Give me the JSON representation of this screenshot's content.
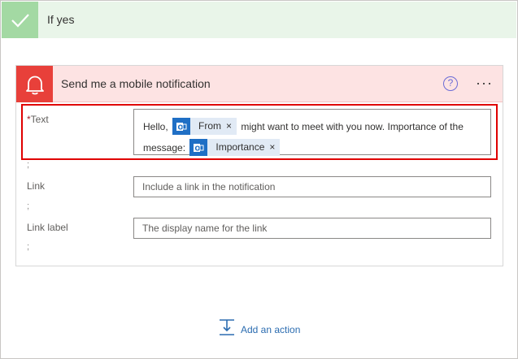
{
  "branch": {
    "title": "If yes",
    "check_icon": "checkmark-icon"
  },
  "card": {
    "title": "Send me a mobile notification",
    "icon": "bell-icon",
    "help_symbol": "?",
    "more_symbol": "···",
    "accent": "#e8403a"
  },
  "fields": {
    "text": {
      "required_mark": "*",
      "label": "Text",
      "segments": {
        "s1": "Hello,",
        "token_from": "From",
        "s2": "might want to meet with you now. Importance of the message:",
        "token_importance": "Importance"
      },
      "token_close": "×"
    },
    "text_semicolon": ";",
    "link": {
      "label": "Link",
      "placeholder": "Include a link in the notification",
      "semicolon": ";"
    },
    "link_label": {
      "label": "Link label",
      "placeholder": "The display name for the link",
      "semicolon": ";"
    }
  },
  "footer": {
    "add_action": "Add an action",
    "add_icon": "add-step-icon"
  }
}
